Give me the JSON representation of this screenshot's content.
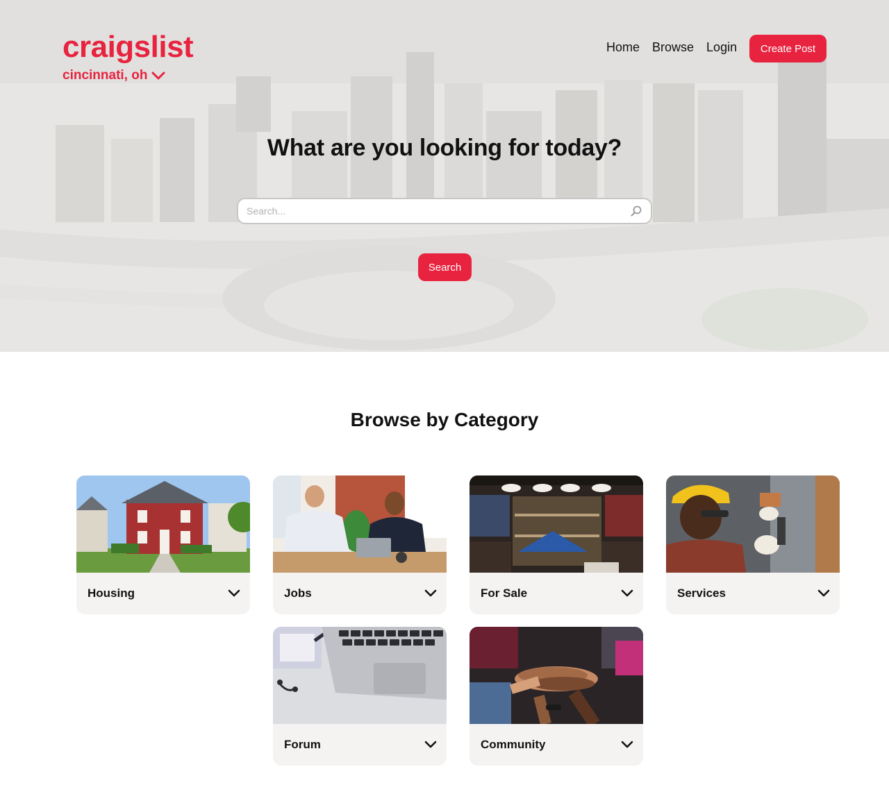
{
  "header": {
    "logo": "craigslist",
    "city": "cincinnati, oh",
    "nav": [
      "Home",
      "Browse",
      "Login"
    ],
    "create_post": "Create Post"
  },
  "hero": {
    "title": "What are you looking for today?",
    "search_placeholder": "Search...",
    "search_button": "Search"
  },
  "categories": {
    "title": "Browse by Category",
    "items": [
      {
        "label": "Housing",
        "image": "red house photo"
      },
      {
        "label": "Jobs",
        "image": "office high-five photo"
      },
      {
        "label": "For Sale",
        "image": "clothing store shelves photo"
      },
      {
        "label": "Services",
        "image": "electrician at panel photo"
      },
      {
        "label": "Forum",
        "image": "laptop on desk photo"
      },
      {
        "label": "Community",
        "image": "stacked hands photo"
      }
    ]
  },
  "colors": {
    "accent": "#e8233f"
  }
}
